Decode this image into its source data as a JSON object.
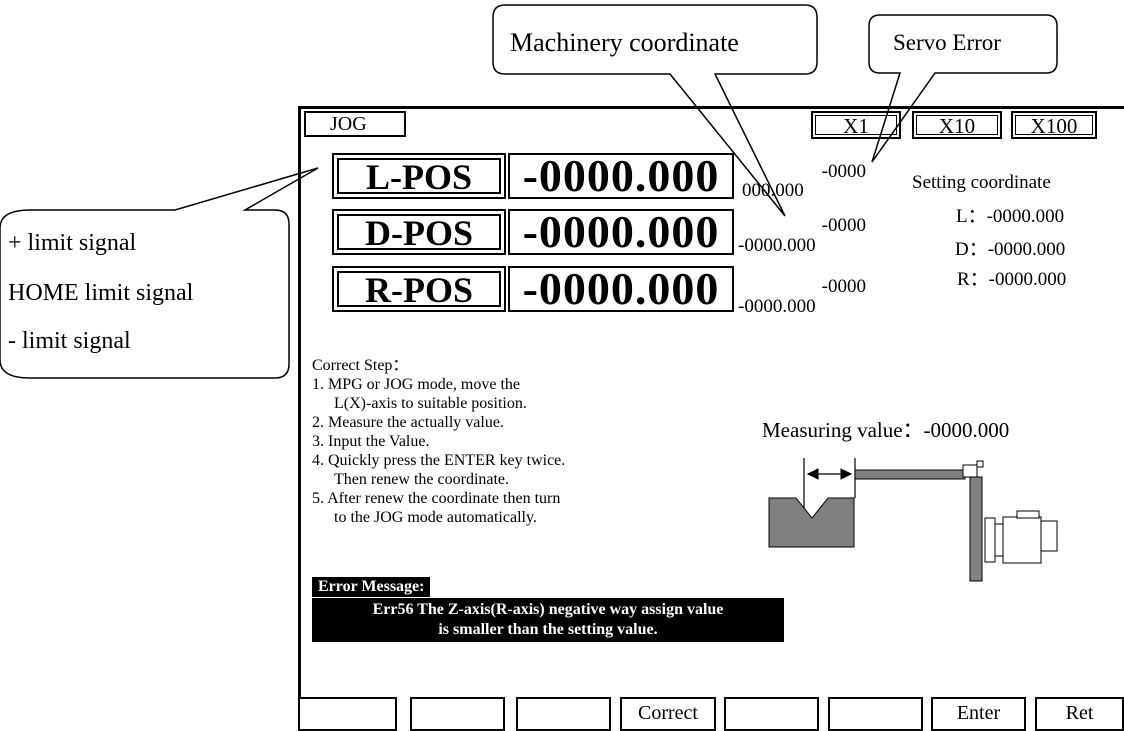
{
  "mode": "JOG",
  "multipliers": [
    "X1",
    "X10",
    "X100"
  ],
  "axes": [
    {
      "label": "L-POS",
      "value": "-0000.000",
      "servo_error": "-0000",
      "machinery": "000.000"
    },
    {
      "label": "D-POS",
      "value": "-0000.000",
      "servo_error": "-0000",
      "machinery": "-0000.000"
    },
    {
      "label": "R-POS",
      "value": "-0000.000",
      "servo_error": "-0000",
      "machinery": "-0000.000"
    }
  ],
  "setting": {
    "title": "Setting coordinate",
    "rows": [
      "L：-0000.000",
      "D：-0000.000",
      "R：-0000.000"
    ]
  },
  "steps": {
    "title": "Correct Step：",
    "lines": [
      "1. MPG or JOG mode, move the",
      "L(X)-axis to suitable position.",
      "2. Measure the actually value.",
      "3. Input the Value.",
      "4. Quickly press the ENTER key twice.",
      "Then renew the coordinate.",
      "5. After renew the coordinate then turn",
      "to the JOG mode automatically."
    ]
  },
  "measuring": "Measuring value：-0000.000",
  "error": {
    "title": "Error Message:",
    "line1": "Err56 The Z-axis(R-axis) negative way assign value",
    "line2": "is smaller than the setting value."
  },
  "function_keys": [
    "",
    "",
    "",
    "Correct",
    "",
    "",
    "Enter",
    "Ret"
  ],
  "callouts": {
    "machinery": "Machinery coordinate",
    "servo": "Servo Error",
    "limit_lines": [
      "+ limit signal",
      "HOME limit signal",
      "- limit signal"
    ]
  }
}
